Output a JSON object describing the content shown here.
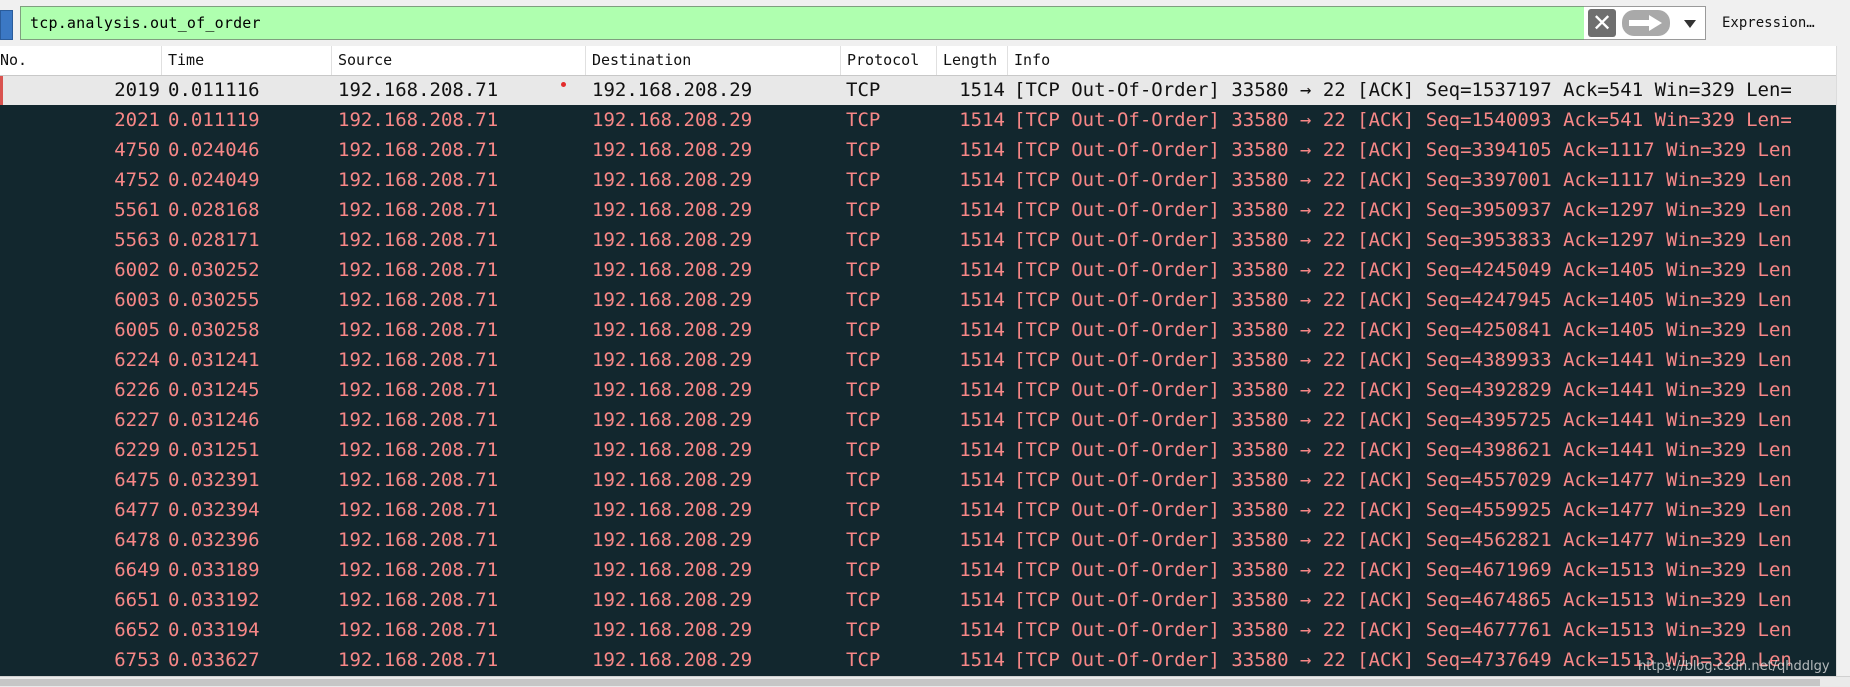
{
  "filter": {
    "value": "tcp.analysis.out_of_order",
    "clear_glyph": "✕",
    "expression_label": "Expression…"
  },
  "columns": {
    "no": "No.",
    "time": "Time",
    "source": "Source",
    "destination": "Destination",
    "protocol": "Protocol",
    "length": "Length",
    "info": "Info"
  },
  "colors": {
    "filter_valid_bg": "#afffaf",
    "row_bg": "#12272e",
    "row_fg": "#f78787",
    "selected_bg": "#e8e8e8"
  },
  "packets": [
    {
      "no": "2019",
      "time": "0.011116",
      "source": "192.168.208.71",
      "destination": "192.168.208.29",
      "protocol": "TCP",
      "length": "1514",
      "info": "[TCP Out-Of-Order] 33580 → 22 [ACK] Seq=1537197 Ack=541 Win=329 Len=",
      "selected": true
    },
    {
      "no": "2021",
      "time": "0.011119",
      "source": "192.168.208.71",
      "destination": "192.168.208.29",
      "protocol": "TCP",
      "length": "1514",
      "info": "[TCP Out-Of-Order] 33580 → 22 [ACK] Seq=1540093 Ack=541 Win=329 Len="
    },
    {
      "no": "4750",
      "time": "0.024046",
      "source": "192.168.208.71",
      "destination": "192.168.208.29",
      "protocol": "TCP",
      "length": "1514",
      "info": "[TCP Out-Of-Order] 33580 → 22 [ACK] Seq=3394105 Ack=1117 Win=329 Len"
    },
    {
      "no": "4752",
      "time": "0.024049",
      "source": "192.168.208.71",
      "destination": "192.168.208.29",
      "protocol": "TCP",
      "length": "1514",
      "info": "[TCP Out-Of-Order] 33580 → 22 [ACK] Seq=3397001 Ack=1117 Win=329 Len"
    },
    {
      "no": "5561",
      "time": "0.028168",
      "source": "192.168.208.71",
      "destination": "192.168.208.29",
      "protocol": "TCP",
      "length": "1514",
      "info": "[TCP Out-Of-Order] 33580 → 22 [ACK] Seq=3950937 Ack=1297 Win=329 Len"
    },
    {
      "no": "5563",
      "time": "0.028171",
      "source": "192.168.208.71",
      "destination": "192.168.208.29",
      "protocol": "TCP",
      "length": "1514",
      "info": "[TCP Out-Of-Order] 33580 → 22 [ACK] Seq=3953833 Ack=1297 Win=329 Len"
    },
    {
      "no": "6002",
      "time": "0.030252",
      "source": "192.168.208.71",
      "destination": "192.168.208.29",
      "protocol": "TCP",
      "length": "1514",
      "info": "[TCP Out-Of-Order] 33580 → 22 [ACK] Seq=4245049 Ack=1405 Win=329 Len"
    },
    {
      "no": "6003",
      "time": "0.030255",
      "source": "192.168.208.71",
      "destination": "192.168.208.29",
      "protocol": "TCP",
      "length": "1514",
      "info": "[TCP Out-Of-Order] 33580 → 22 [ACK] Seq=4247945 Ack=1405 Win=329 Len"
    },
    {
      "no": "6005",
      "time": "0.030258",
      "source": "192.168.208.71",
      "destination": "192.168.208.29",
      "protocol": "TCP",
      "length": "1514",
      "info": "[TCP Out-Of-Order] 33580 → 22 [ACK] Seq=4250841 Ack=1405 Win=329 Len"
    },
    {
      "no": "6224",
      "time": "0.031241",
      "source": "192.168.208.71",
      "destination": "192.168.208.29",
      "protocol": "TCP",
      "length": "1514",
      "info": "[TCP Out-Of-Order] 33580 → 22 [ACK] Seq=4389933 Ack=1441 Win=329 Len"
    },
    {
      "no": "6226",
      "time": "0.031245",
      "source": "192.168.208.71",
      "destination": "192.168.208.29",
      "protocol": "TCP",
      "length": "1514",
      "info": "[TCP Out-Of-Order] 33580 → 22 [ACK] Seq=4392829 Ack=1441 Win=329 Len"
    },
    {
      "no": "6227",
      "time": "0.031246",
      "source": "192.168.208.71",
      "destination": "192.168.208.29",
      "protocol": "TCP",
      "length": "1514",
      "info": "[TCP Out-Of-Order] 33580 → 22 [ACK] Seq=4395725 Ack=1441 Win=329 Len"
    },
    {
      "no": "6229",
      "time": "0.031251",
      "source": "192.168.208.71",
      "destination": "192.168.208.29",
      "protocol": "TCP",
      "length": "1514",
      "info": "[TCP Out-Of-Order] 33580 → 22 [ACK] Seq=4398621 Ack=1441 Win=329 Len"
    },
    {
      "no": "6475",
      "time": "0.032391",
      "source": "192.168.208.71",
      "destination": "192.168.208.29",
      "protocol": "TCP",
      "length": "1514",
      "info": "[TCP Out-Of-Order] 33580 → 22 [ACK] Seq=4557029 Ack=1477 Win=329 Len"
    },
    {
      "no": "6477",
      "time": "0.032394",
      "source": "192.168.208.71",
      "destination": "192.168.208.29",
      "protocol": "TCP",
      "length": "1514",
      "info": "[TCP Out-Of-Order] 33580 → 22 [ACK] Seq=4559925 Ack=1477 Win=329 Len"
    },
    {
      "no": "6478",
      "time": "0.032396",
      "source": "192.168.208.71",
      "destination": "192.168.208.29",
      "protocol": "TCP",
      "length": "1514",
      "info": "[TCP Out-Of-Order] 33580 → 22 [ACK] Seq=4562821 Ack=1477 Win=329 Len"
    },
    {
      "no": "6649",
      "time": "0.033189",
      "source": "192.168.208.71",
      "destination": "192.168.208.29",
      "protocol": "TCP",
      "length": "1514",
      "info": "[TCP Out-Of-Order] 33580 → 22 [ACK] Seq=4671969 Ack=1513 Win=329 Len"
    },
    {
      "no": "6651",
      "time": "0.033192",
      "source": "192.168.208.71",
      "destination": "192.168.208.29",
      "protocol": "TCP",
      "length": "1514",
      "info": "[TCP Out-Of-Order] 33580 → 22 [ACK] Seq=4674865 Ack=1513 Win=329 Len"
    },
    {
      "no": "6652",
      "time": "0.033194",
      "source": "192.168.208.71",
      "destination": "192.168.208.29",
      "protocol": "TCP",
      "length": "1514",
      "info": "[TCP Out-Of-Order] 33580 → 22 [ACK] Seq=4677761 Ack=1513 Win=329 Len"
    },
    {
      "no": "6753",
      "time": "0.033627",
      "source": "192.168.208.71",
      "destination": "192.168.208.29",
      "protocol": "TCP",
      "length": "1514",
      "info": "[TCP Out-Of-Order] 33580 → 22 [ACK] Seq=4737649 Ack=1513 Win=329 Len"
    }
  ],
  "watermark": "https://blog.csdn.net/qhddlgy"
}
